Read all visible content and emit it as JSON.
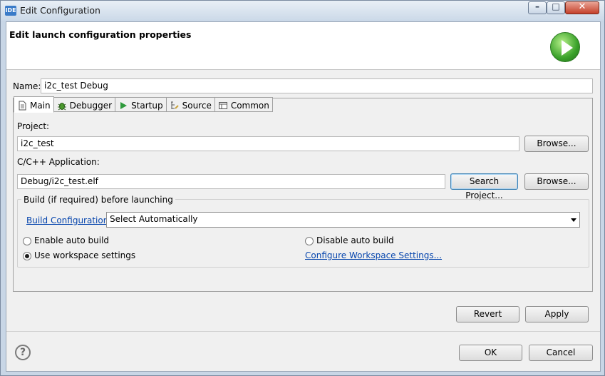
{
  "window": {
    "app_icon": "IDE",
    "title": "Edit Configuration",
    "min_glyph": "–",
    "max_glyph": "□",
    "close_glyph": "✕"
  },
  "header": {
    "title": "Edit launch configuration properties",
    "icon": "run-icon"
  },
  "name": {
    "label": "Name:",
    "value": "i2c_test Debug"
  },
  "tabs": [
    {
      "label": "Main",
      "icon": "document-icon",
      "active": true
    },
    {
      "label": "Debugger",
      "icon": "bug-icon",
      "active": false
    },
    {
      "label": "Startup",
      "icon": "play-icon",
      "active": false
    },
    {
      "label": "Source",
      "icon": "source-icon",
      "active": false
    },
    {
      "label": "Common",
      "icon": "common-icon",
      "active": false
    }
  ],
  "main": {
    "project_label": "Project:",
    "project_value": "i2c_test",
    "project_browse": "Browse...",
    "app_label": "C/C++ Application:",
    "app_value": "Debug/i2c_test.elf",
    "search_project": "Search Project...",
    "app_browse": "Browse...",
    "build": {
      "group_title": "Build (if required) before launching",
      "config_link": "Build Configuration:",
      "config_value": "Select Automatically",
      "enable_auto": "Enable auto build",
      "disable_auto": "Disable auto build",
      "use_workspace": "Use workspace settings",
      "configure_link": "Configure Workspace Settings..."
    }
  },
  "actions": {
    "revert": "Revert",
    "apply": "Apply"
  },
  "footer": {
    "help": "?",
    "ok": "OK",
    "cancel": "Cancel"
  }
}
